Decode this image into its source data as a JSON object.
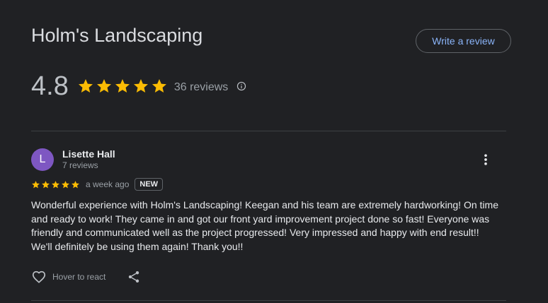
{
  "business": {
    "name": "Holm's Landscaping",
    "write_review_label": "Write a review"
  },
  "rating": {
    "value": "4.8",
    "stars": 5,
    "reviews_label": "36 reviews",
    "star_color": "#fbbc04"
  },
  "review": {
    "avatar_initial": "L",
    "avatar_color": "#7e57c2",
    "author_name": "Lisette Hall",
    "author_meta": "7 reviews",
    "stars": 5,
    "time": "a week ago",
    "badge": "NEW",
    "text": "Wonderful experience with Holm's Landscaping! Keegan and his team are extremely hardworking! On time and ready to work! They came in and got our front yard improvement project done so fast! Everyone was friendly and communicated well as the project progressed! Very impressed and happy with end result!! We'll definitely be using them again! Thank you!!",
    "react_label": "Hover to react"
  },
  "icons": {
    "star": "star-icon",
    "info": "info-icon",
    "more": "more-vert-icon",
    "heart": "heart-outline-icon",
    "share": "share-icon"
  }
}
